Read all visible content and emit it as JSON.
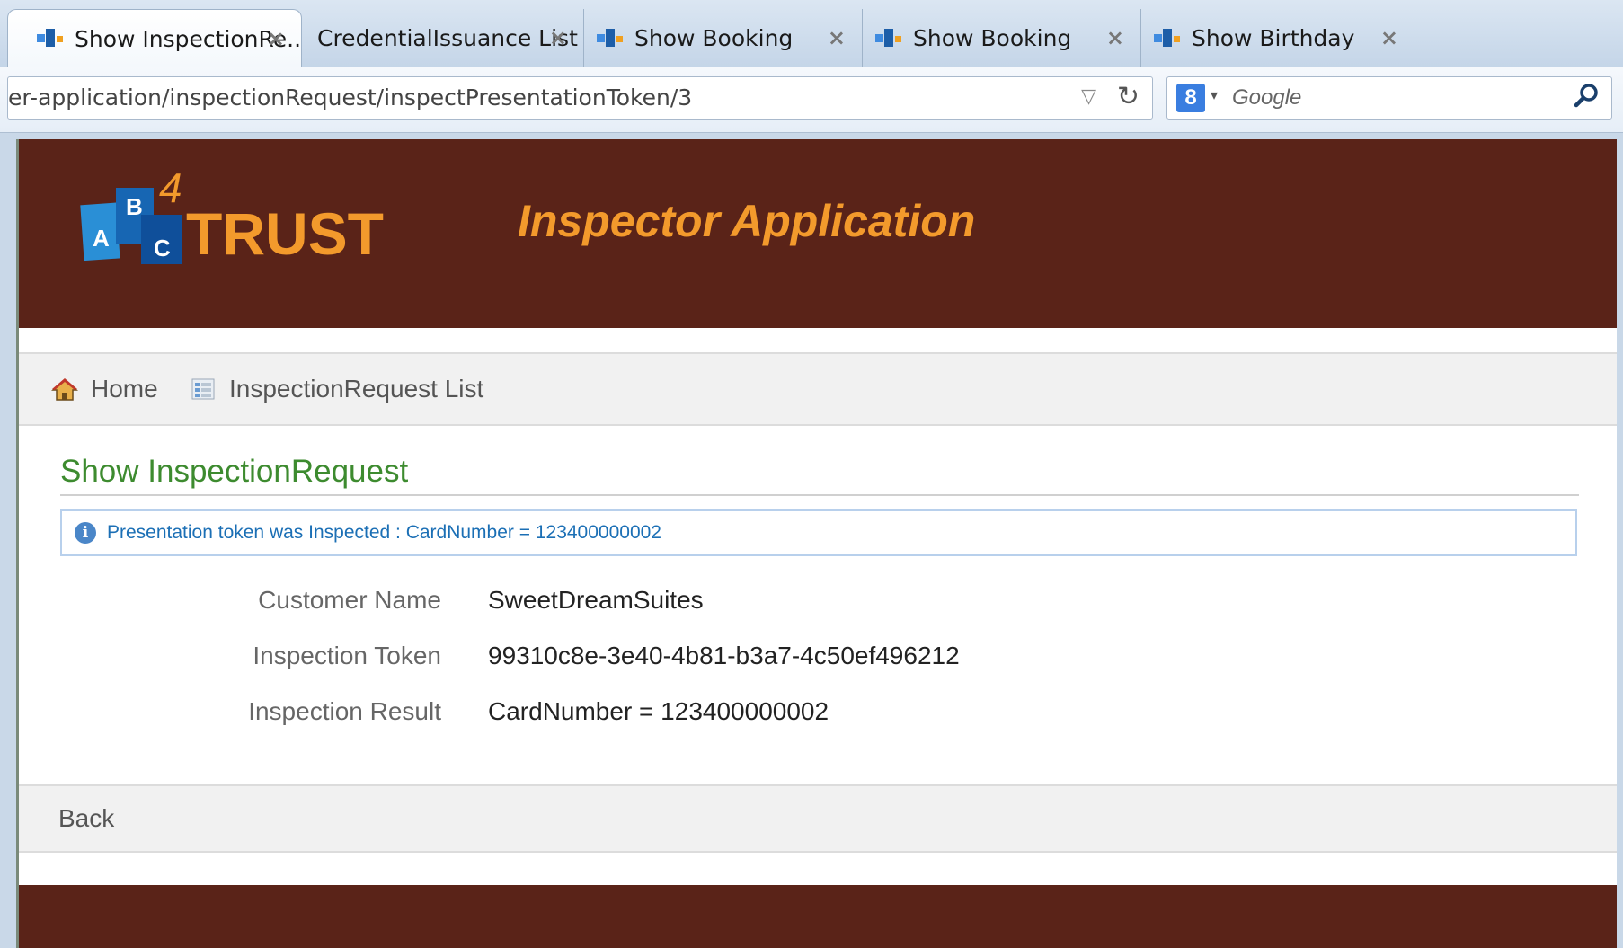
{
  "browser": {
    "tabs": [
      {
        "title": "Show InspectionRe...",
        "active": true,
        "icon": "app-favicon-icon"
      },
      {
        "title": "CredentialIssuance List",
        "active": false,
        "icon": "none"
      },
      {
        "title": "Show Booking",
        "active": false,
        "icon": "app-favicon-icon"
      },
      {
        "title": "Show Booking",
        "active": false,
        "icon": "app-favicon-icon"
      },
      {
        "title": "Show Birthday",
        "active": false,
        "icon": "app-favicon-icon"
      }
    ],
    "close_glyph": "×",
    "url": "er-application/inspectionRequest/inspectPresentationToken/3",
    "search_engine_letter": "8",
    "search_placeholder": "Google"
  },
  "header": {
    "logo_letters": [
      "A",
      "B",
      "C"
    ],
    "logo_superscript": "4",
    "logo_word": "TRUST",
    "app_title": "Inspector Application"
  },
  "nav": {
    "home_label": "Home",
    "list_label": "InspectionRequest List"
  },
  "main": {
    "title": "Show InspectionRequest",
    "message": "Presentation token was Inspected : CardNumber = 123400000002",
    "fields": [
      {
        "label": "Customer Name",
        "value": "SweetDreamSuites"
      },
      {
        "label": "Inspection Token",
        "value": "99310c8e-3e40-4b81-b3a7-4c50ef496212"
      },
      {
        "label": "Inspection Result",
        "value": "CardNumber = 123400000002"
      }
    ]
  },
  "buttons": {
    "back_label": "Back"
  },
  "colors": {
    "header_bg": "#5a2318",
    "title_orange": "#f39a2c",
    "section_green": "#3d8b2f",
    "message_blue": "#1b6fb5"
  }
}
